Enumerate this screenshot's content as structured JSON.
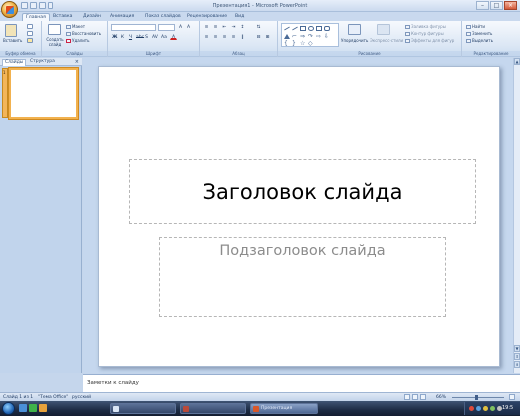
{
  "window": {
    "title": "Презентация1 - Microsoft PowerPoint",
    "controls": {
      "minimize": "–",
      "maximize": "□",
      "close": "×"
    }
  },
  "tabs": [
    {
      "label": "Главная",
      "active": true
    },
    {
      "label": "Вставка"
    },
    {
      "label": "Дизайн"
    },
    {
      "label": "Анимация"
    },
    {
      "label": "Показ слайдов"
    },
    {
      "label": "Рецензирование"
    },
    {
      "label": "Вид"
    }
  ],
  "ribbon": {
    "clipboard": {
      "label": "Буфер обмена",
      "paste": "Вставить"
    },
    "slides": {
      "label": "Слайды",
      "new_slide": "Создать слайд",
      "layout": "Макет",
      "reset": "Восстановить",
      "delete": "Удалить"
    },
    "font": {
      "label": "Шрифт"
    },
    "paragraph": {
      "label": "Абзац"
    },
    "drawing": {
      "label": "Рисование",
      "arrange": "Упорядочить",
      "quick_styles": "Экспресс-стили",
      "fill": "Заливка фигуры",
      "outline": "Контур фигуры",
      "effects": "Эффекты для фигур"
    },
    "editing": {
      "label": "Редактирование",
      "find": "Найти",
      "replace": "Заменить",
      "select": "Выделить"
    }
  },
  "left_pane": {
    "tabs": [
      {
        "label": "Слайды",
        "active": true
      },
      {
        "label": "Структура"
      }
    ],
    "close": "×",
    "slide_number": "1"
  },
  "slide": {
    "title": "Заголовок слайда",
    "subtitle": "Подзаголовок слайда"
  },
  "notes": {
    "placeholder": "Заметки к слайду"
  },
  "status": {
    "slide": "Слайд 1 из 1",
    "theme": "\"Тема Office\"",
    "language": "русский",
    "zoom": "66%"
  },
  "taskbar": {
    "clock": "19:5",
    "buttons": [
      {
        "label": ""
      },
      {
        "label": ""
      },
      {
        "label": "Презентация"
      }
    ]
  },
  "colors": {
    "accent": "#f2b24f",
    "ribbon": "#dce7f5",
    "taskbar": "#1d2b44"
  }
}
